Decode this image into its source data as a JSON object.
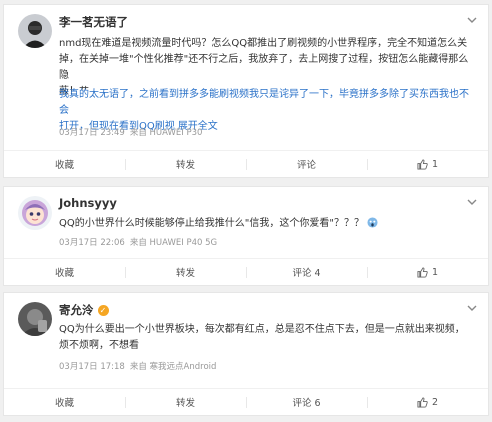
{
  "posts": [
    {
      "username": "李一茗无语了",
      "verified": false,
      "text_lines": [
        "nmd现在难道是视频流量时代吗？怎么QQ都推出了刷视频的小世界程序，完全不知道怎么关",
        "掉，在关掉一堆\"个性化推荐\"还不行之后，我放弃了，去上网搜了过程，按钮怎么能藏得那么隐",
        "蔽！艹"
      ],
      "text_lines_blue": [
        "我真的太无语了，之前看到拼多多能刷视频我只是诧异了一下，毕竟拼多多除了买东西我也不会",
        "打开，但现在看到QQ刷视"
      ],
      "expand_label": "展开全文",
      "timestamp": "03月17日 23:49",
      "source": "来自 HUAWEI P30",
      "actions": {
        "favorite": "收藏",
        "repost": "转发",
        "comment": "评论",
        "like": "1"
      }
    },
    {
      "username": "Johnsyyy",
      "verified": false,
      "text_lines": [
        "QQ的小世界什么时候能够停止给我推什么\"信我，这个你爱看\"？？？"
      ],
      "timestamp": "03月17日 22:06",
      "source": "来自 HUAWEI P40 5G",
      "actions": {
        "favorite": "收藏",
        "repost": "转发",
        "comment": "评论 4",
        "like": "1"
      }
    },
    {
      "username": "寄允泠",
      "verified": true,
      "text_lines": [
        "QQ为什么要出一个小世界板块，每次都有红点，总是忍不住点下去，但是一点就出来视频，",
        "烦不烦啊，不想看"
      ],
      "timestamp": "03月17日 17:18",
      "source": "来自 寒我远点Android",
      "actions": {
        "favorite": "收藏",
        "repost": "转发",
        "comment": "评论 6",
        "like": "2"
      }
    }
  ],
  "colors": {
    "link": "#2a71c8",
    "meta": "#999999",
    "verified": "#f5a623"
  }
}
